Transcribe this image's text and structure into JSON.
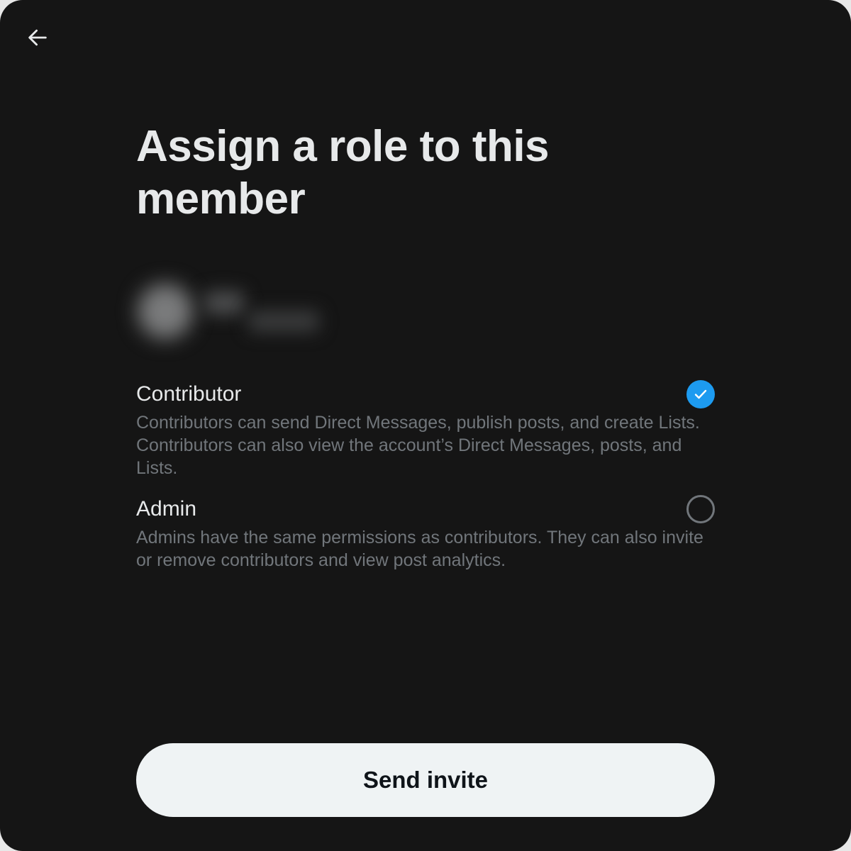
{
  "header": {
    "back_icon": "arrow-left-icon"
  },
  "title": "Assign a role to this member",
  "member": {
    "redacted": true
  },
  "roles": [
    {
      "name": "Contributor",
      "description": "Contributors can send Direct Messages, publish posts, and create Lists. Contributors can also view the account’s Direct Messages, posts, and Lists.",
      "selected": true
    },
    {
      "name": "Admin",
      "description": "Admins have the same permissions as contributors. They can also invite or remove contributors and view post analytics.",
      "selected": false
    }
  ],
  "actions": {
    "send_label": "Send invite"
  },
  "colors": {
    "background": "#151515",
    "accent": "#1d9bf0",
    "primary_text": "#e7e9ea",
    "secondary_text": "#71767b",
    "button_bg": "#eff3f4",
    "button_text": "#0f1419"
  }
}
